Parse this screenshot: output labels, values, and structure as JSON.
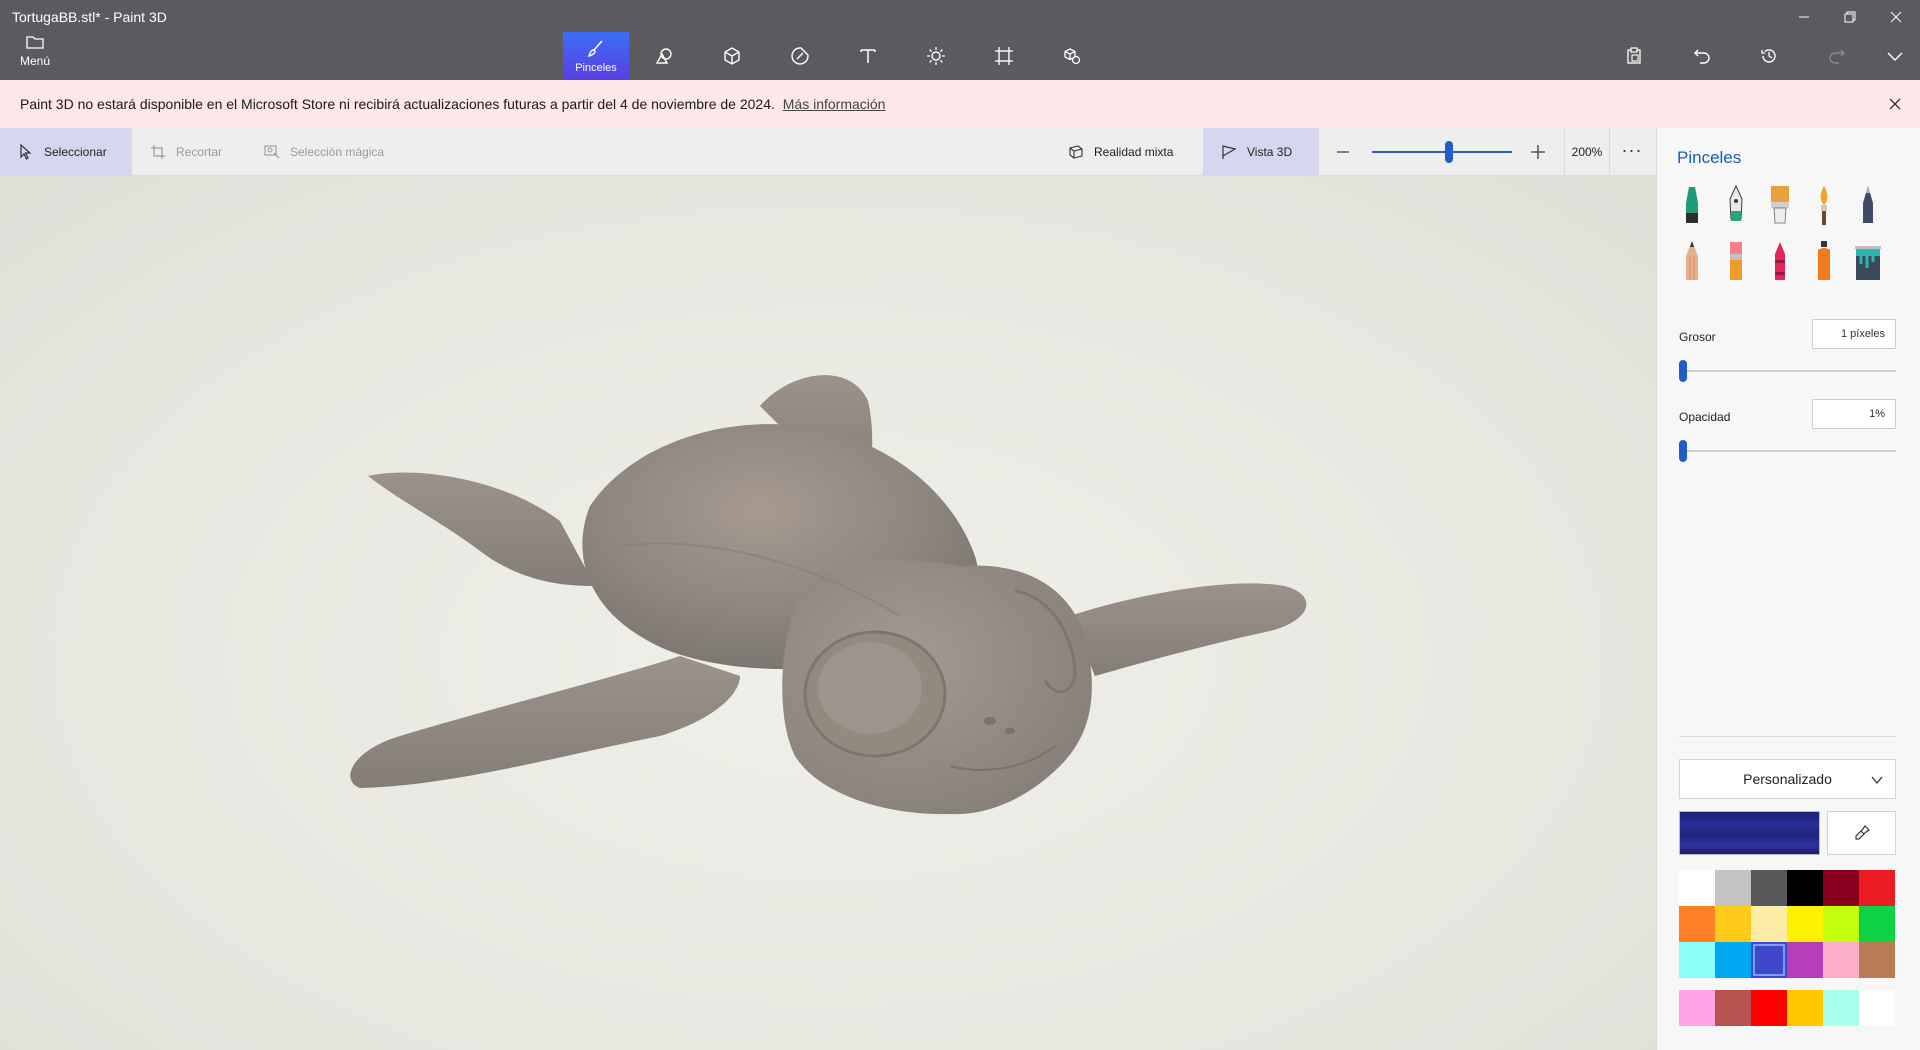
{
  "window": {
    "title": "TortugaBB.stl* - Paint 3D",
    "menu_label": "Menú",
    "controls": [
      "minimize-icon",
      "restore-icon",
      "close-icon"
    ]
  },
  "main_toolbar": {
    "tools": [
      {
        "id": "brushes",
        "label": "Pinceles",
        "icon": "brush-icon",
        "active": true
      },
      {
        "id": "2d-shapes",
        "label": "",
        "icon": "2d-shapes-icon"
      },
      {
        "id": "3d-shapes",
        "label": "",
        "icon": "3d-shapes-icon"
      },
      {
        "id": "stickers",
        "label": "",
        "icon": "sticker-icon"
      },
      {
        "id": "text",
        "label": "",
        "icon": "text-icon"
      },
      {
        "id": "effects",
        "label": "",
        "icon": "effects-icon"
      },
      {
        "id": "canvas",
        "label": "",
        "icon": "canvas-icon"
      },
      {
        "id": "3d-library",
        "label": "",
        "icon": "3d-library-icon"
      }
    ],
    "right_tools": [
      "paste-icon",
      "undo-icon",
      "history-icon",
      "redo-icon",
      "expand-icon"
    ]
  },
  "notice": {
    "text": "Paint 3D no estará disponible en el Microsoft Store ni recibirá actualizaciones futuras a partir del 4 de noviembre de 2024.",
    "link": "Más información",
    "accent": "#fde7e9"
  },
  "subtoolbar": {
    "select": "Seleccionar",
    "crop": "Recortar",
    "magic_select": "Selección mágica",
    "mixed_reality": "Realidad mixta",
    "view_3d": "Vista 3D",
    "zoom": "200%",
    "zoom_level_fraction": 0.55,
    "more": "···"
  },
  "panel": {
    "title": "Pinceles",
    "brushes": [
      {
        "name": "marker",
        "color": "#1f9a7a"
      },
      {
        "name": "calligraphy-pen",
        "color": "#2aa37f"
      },
      {
        "name": "oil-brush",
        "color": "#e8a23a"
      },
      {
        "name": "watercolor",
        "color": "#f0a32c"
      },
      {
        "name": "pixel-pen",
        "color": "#3f4a6a"
      },
      {
        "name": "pencil",
        "color": "#e8b08a"
      },
      {
        "name": "eraser",
        "color": "#f0808a"
      },
      {
        "name": "crayon",
        "color": "#e0285a"
      },
      {
        "name": "spray-can",
        "color": "#f07a1e"
      },
      {
        "name": "fill-bucket",
        "color": "#2fb3b0"
      }
    ],
    "thickness_label": "Grosor",
    "thickness_value": "1 píxeles",
    "thickness_level": 0.0,
    "opacity_label": "Opacidad",
    "opacity_value": "1%",
    "opacity_level": 0.0,
    "color_mode": "Personalizado",
    "current_color": "#2a2f9a",
    "palette": [
      "#ffffff",
      "#c3c3c3",
      "#585858",
      "#000000",
      "#88001b",
      "#ec1c24",
      "#ff7f27",
      "#ffca18",
      "#fdeca6",
      "#fff200",
      "#c4ff0e",
      "#0ed145",
      "#8cfffb",
      "#00a8f3",
      "#3f48cc",
      "#b83dba",
      "#ffaec8",
      "#b97a56"
    ],
    "selected_swatch": 14,
    "custom_colors": [
      "#ffa3e6",
      "#b85450",
      "#ff0000",
      "#ffc800",
      "#a8ffeb",
      "#ffffff"
    ]
  }
}
